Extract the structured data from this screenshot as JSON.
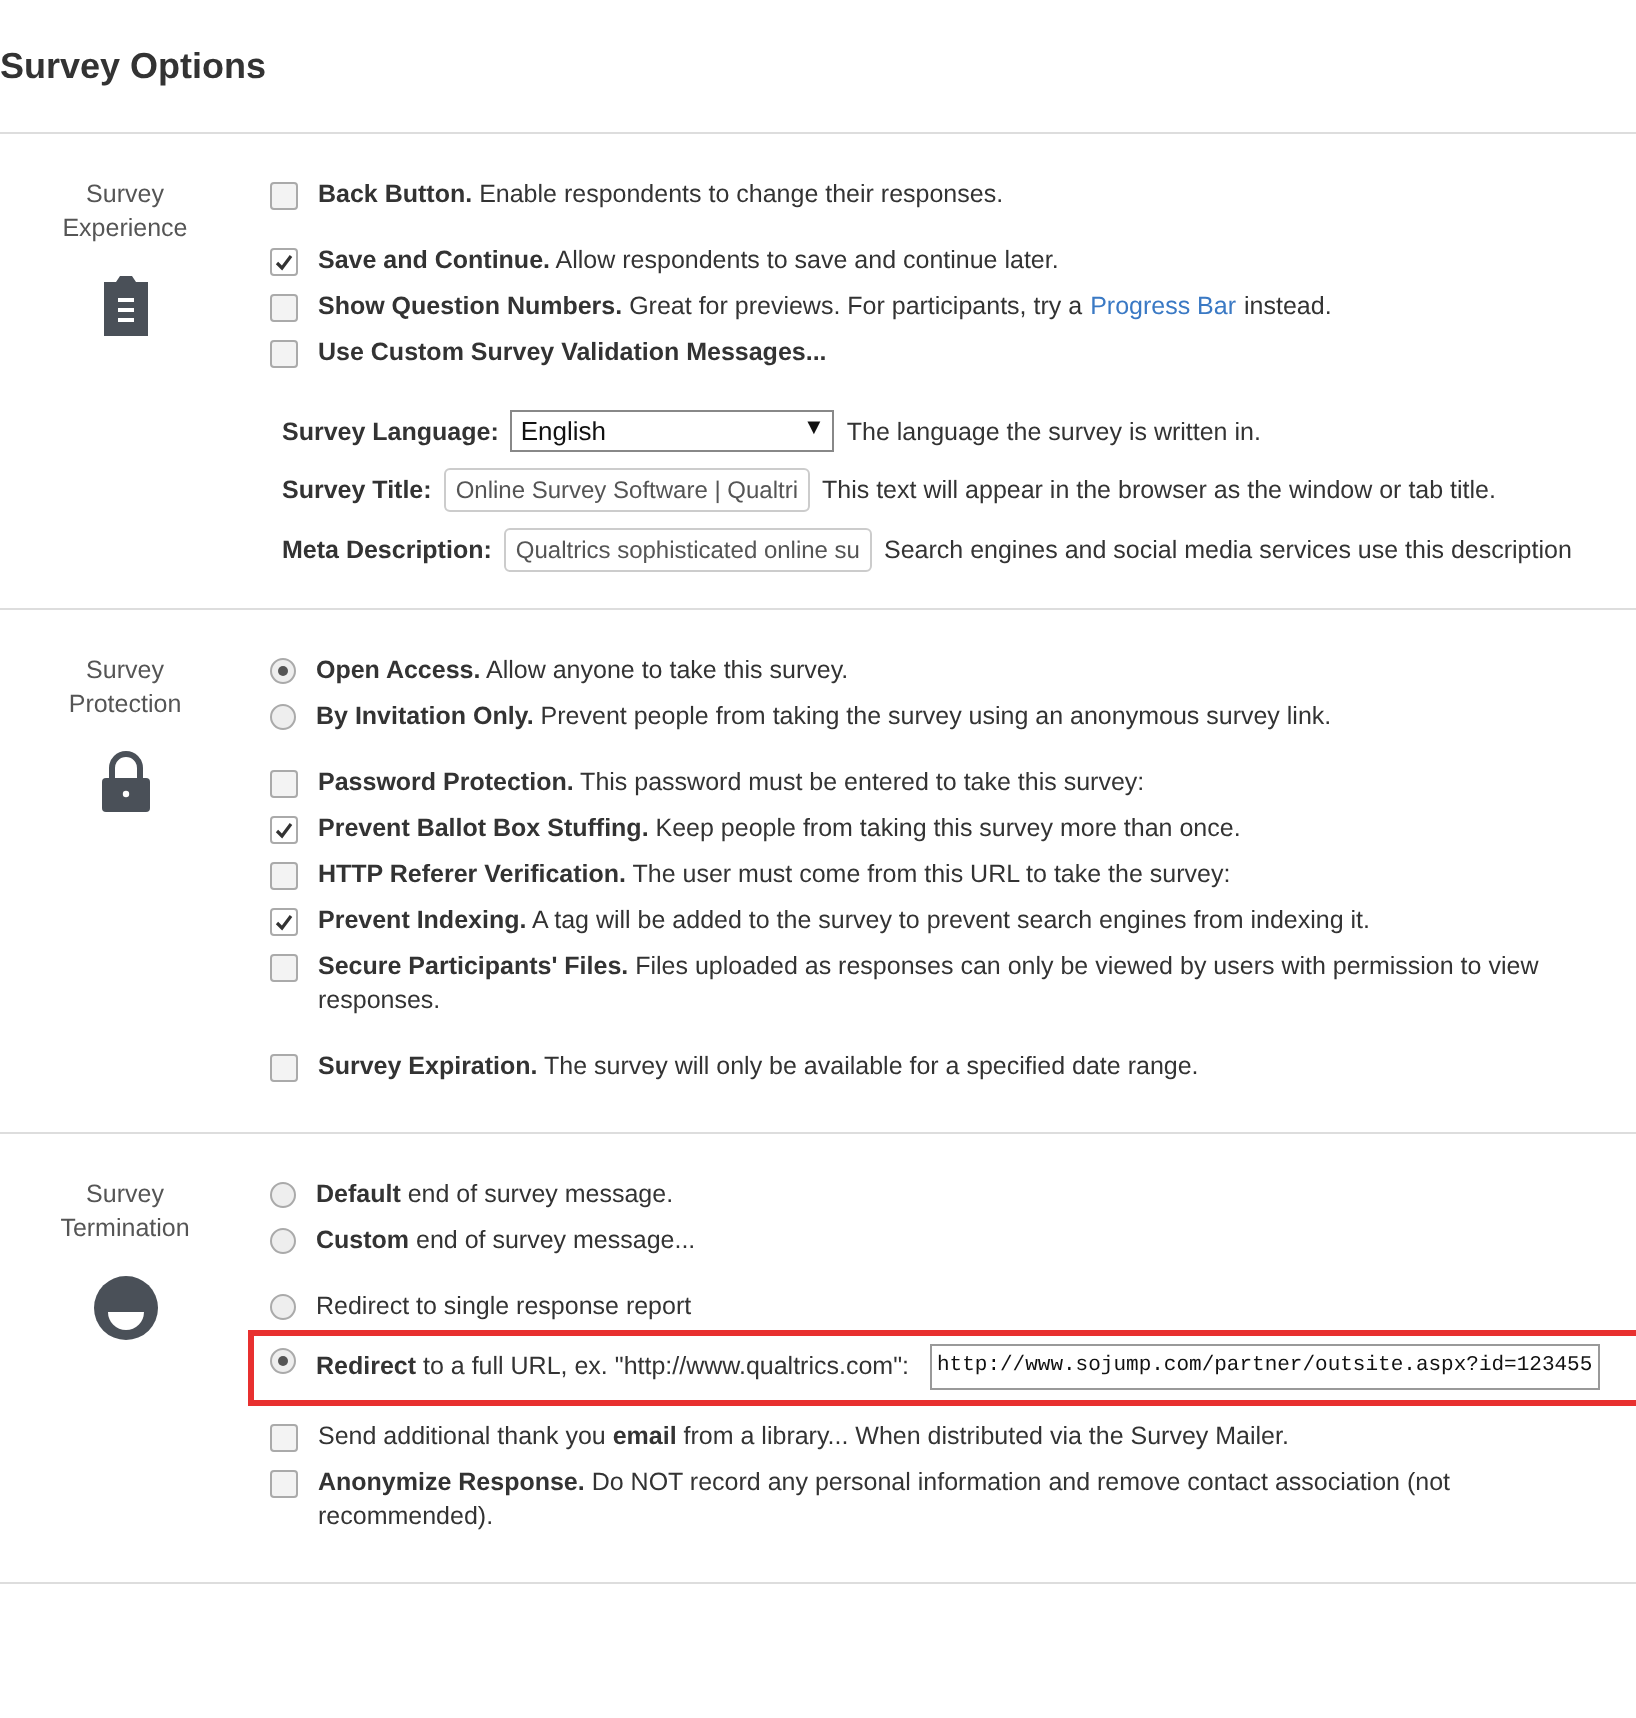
{
  "title": "Survey Options",
  "sections": [
    {
      "label": "Survey Experience",
      "option_groups": [
        [
          {
            "kind": "checkbox",
            "checked": false,
            "text": "**Back Button.** Enable respondents to change their responses."
          }
        ],
        [
          {
            "kind": "checkbox",
            "checked": true,
            "text": "**Save and Continue.** Allow respondents to save and continue later."
          },
          {
            "kind": "checkbox",
            "checked": false,
            "text": "**Show Question Numbers.** Great for previews. For participants, try a",
            "link": "Progress Bar",
            "text_after": "instead."
          },
          {
            "kind": "checkbox",
            "checked": false,
            "text": "**Use Custom Survey Validation Messages...**"
          }
        ]
      ],
      "fields": [
        {
          "kind": "select",
          "label": "Survey Language:",
          "value": "English",
          "arrow": "▼",
          "hint": "The language the survey is written in."
        },
        {
          "kind": "input",
          "label": "Survey Title:",
          "value": "Online Survey Software | Qualtri",
          "hint": "This text will appear in the browser as the window or tab title."
        },
        {
          "kind": "input",
          "label": "Meta Description:",
          "value": "Qualtrics sophisticated online su",
          "hint": "Search engines and social media services use this description"
        }
      ]
    },
    {
      "label": "Survey Protection",
      "option_groups": [
        [
          {
            "kind": "radio",
            "selected": true,
            "text": "**Open Access.** Allow anyone to take this survey."
          },
          {
            "kind": "radio",
            "selected": false,
            "text": "**By Invitation Only.** Prevent people from taking the survey using an anonymous survey link."
          }
        ],
        [
          {
            "kind": "checkbox",
            "checked": false,
            "text": "**Password Protection.** This password must be entered to take this survey:"
          },
          {
            "kind": "checkbox",
            "checked": true,
            "text": "**Prevent Ballot Box Stuffing.** Keep people from taking this survey more than once."
          },
          {
            "kind": "checkbox",
            "checked": false,
            "text": "**HTTP Referer Verification.** The user must come from this URL to take the survey:"
          },
          {
            "kind": "checkbox",
            "checked": true,
            "text": "**Prevent Indexing.** A tag will be added to the survey to prevent search engines from indexing it."
          },
          {
            "kind": "checkbox",
            "checked": false,
            "text": "**Secure Participants' Files.** Files uploaded as responses can only be viewed by users with permission to view responses."
          }
        ],
        [
          {
            "kind": "checkbox",
            "checked": false,
            "text": "**Survey Expiration.** The survey will only be available for a specified date range."
          }
        ]
      ]
    },
    {
      "label": "Survey Termination",
      "option_groups": [
        [
          {
            "kind": "radio",
            "selected": false,
            "text": "**Default** end of survey message."
          },
          {
            "kind": "radio",
            "selected": false,
            "text": "**Custom** end of survey message..."
          }
        ],
        [
          {
            "kind": "radio",
            "selected": false,
            "highlighted": false,
            "text": "Redirect to single response report"
          },
          {
            "kind": "radio",
            "selected": true,
            "highlighted": true,
            "text": "**Redirect** to a full URL, ex. \"http://www.qualtrics.com\":",
            "url": "http://www.sojump.com/partner/outsite.aspx?id=123455"
          },
          {
            "kind": "checkbox",
            "checked": false,
            "text": "Send additional thank you **email** from a library... When distributed via the Survey Mailer."
          },
          {
            "kind": "checkbox",
            "checked": false,
            "text": "**Anonymize Response.** Do NOT record any personal information and remove contact association (not recommended)."
          }
        ]
      ]
    }
  ]
}
